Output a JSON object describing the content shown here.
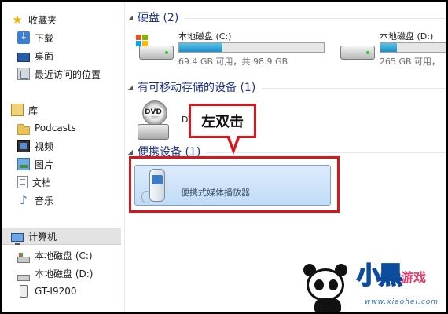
{
  "sidebar": {
    "favorites": {
      "label": "收藏夹",
      "icon": "star-icon"
    },
    "fav_items": [
      {
        "label": "下载",
        "icon": "download-folder-icon"
      },
      {
        "label": "桌面",
        "icon": "desktop-icon"
      },
      {
        "label": "最近访问的位置",
        "icon": "recent-places-icon"
      }
    ],
    "library": {
      "label": "库",
      "icon": "library-icon"
    },
    "lib_items": [
      {
        "label": "Podcasts",
        "icon": "folder-icon"
      },
      {
        "label": "视频",
        "icon": "video-icon"
      },
      {
        "label": "图片",
        "icon": "pictures-icon"
      },
      {
        "label": "文档",
        "icon": "documents-icon"
      },
      {
        "label": "音乐",
        "icon": "music-icon"
      }
    ],
    "computer": {
      "label": "计算机",
      "icon": "computer-icon"
    },
    "comp_items": [
      {
        "label": "本地磁盘 (C:)",
        "icon": "drive-c-icon"
      },
      {
        "label": "本地磁盘 (D:)",
        "icon": "drive-d-icon"
      },
      {
        "label": "GT-I9200",
        "icon": "phone-icon"
      }
    ]
  },
  "content": {
    "hard_disks": {
      "title": "硬盘 (2)",
      "drives": [
        {
          "name": "本地磁盘 (C:)",
          "info": "69.4 GB 可用，共 98.9 GB",
          "used_fraction": 0.3
        },
        {
          "name": "本地磁盘 (D:)",
          "info": "265 GB 可用，",
          "used_fraction": 0.25
        }
      ]
    },
    "removable": {
      "title": "有可移动存储的设备 (1)",
      "device_name": "DV",
      "dvd_label": "DVD"
    },
    "portable": {
      "title": "便携设备 (1)",
      "device_name": "便携式媒体播放器"
    }
  },
  "annotation": {
    "callout_text": "左双击",
    "color": "#d8161c"
  },
  "watermark": {
    "text": "小黑",
    "game": "游戏",
    "url": "www.xiaohei.com"
  },
  "colors": {
    "group_title": "#1e3287",
    "progress": "#1e8fc8",
    "selected_bg": "#e3e3e3"
  }
}
